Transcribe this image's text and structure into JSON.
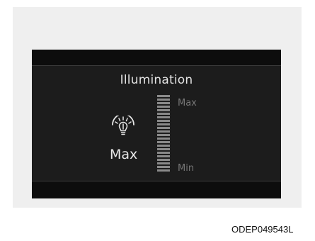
{
  "display": {
    "title": "Illumination",
    "current_value": "Max",
    "icon": "illumination-bulb-icon",
    "scale": {
      "max_label": "Max",
      "min_label": "Min",
      "level_fraction": 1.0
    }
  },
  "image_code": "ODEP049543L",
  "colors": {
    "display_background": "#1c1c1c",
    "bars": "#0d0d0d",
    "text": "#e4e4e4",
    "scale_labels": "#777777"
  }
}
